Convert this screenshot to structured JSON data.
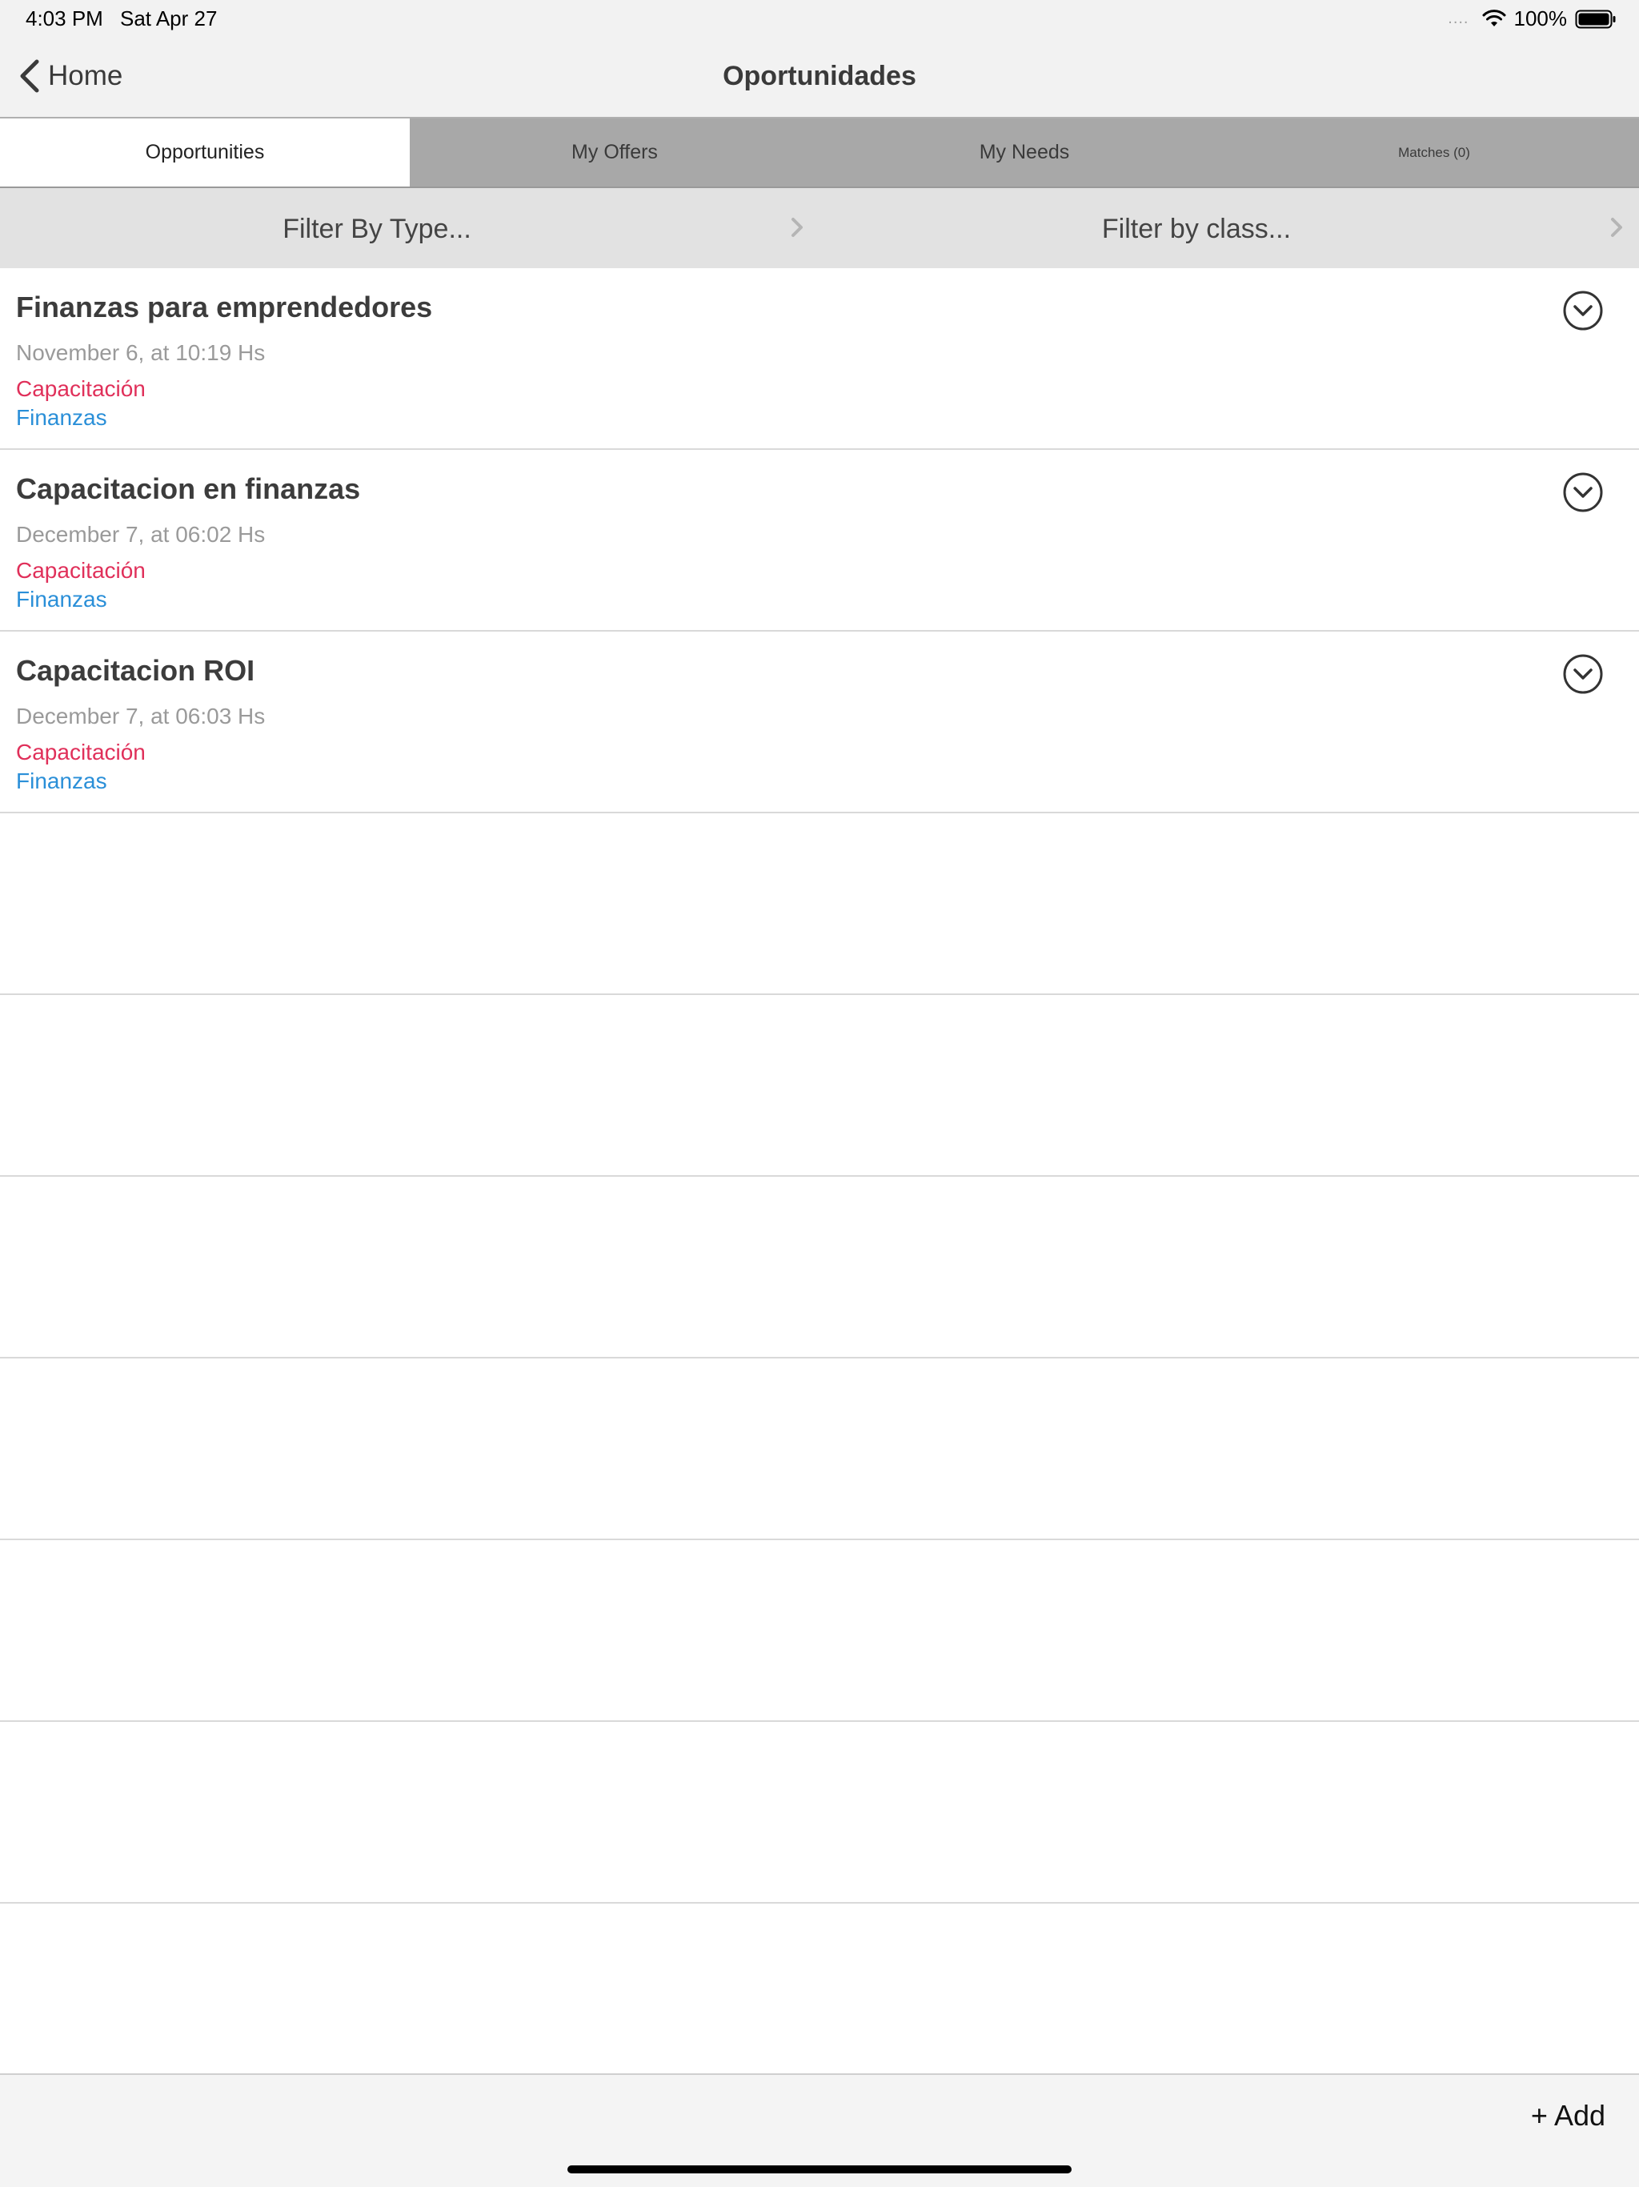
{
  "status_bar": {
    "time": "4:03 PM",
    "date": "Sat Apr 27",
    "signal_dots": "....",
    "battery_percent": "100%"
  },
  "nav": {
    "back_label": "Home",
    "title": "Oportunidades"
  },
  "tabs": [
    {
      "label": "Opportunities",
      "active": true
    },
    {
      "label": "My Offers",
      "active": false
    },
    {
      "label": "My Needs",
      "active": false
    },
    {
      "label": "Matches (0)",
      "active": false
    }
  ],
  "filters": {
    "type_label": "Filter By Type...",
    "class_label": "Filter by class..."
  },
  "items": [
    {
      "name": "Finanzas para emprendedores",
      "date": "November 6, at 10:19 Hs",
      "type": "Capacitación",
      "class": "Finanzas"
    },
    {
      "name": "Capacitacion en finanzas",
      "date": "December 7, at 06:02 Hs",
      "type": "Capacitación",
      "class": "Finanzas"
    },
    {
      "name": "Capacitacion ROI",
      "date": "December 7, at 06:03 Hs",
      "type": "Capacitación",
      "class": "Finanzas"
    }
  ],
  "toolbar": {
    "add_label": "+ Add"
  },
  "colors": {
    "type_color": "#e0305a",
    "class_color": "#2a8fd8",
    "tab_bar_bg": "#a8a8a8",
    "filter_bar_bg": "#e2e2e2"
  }
}
